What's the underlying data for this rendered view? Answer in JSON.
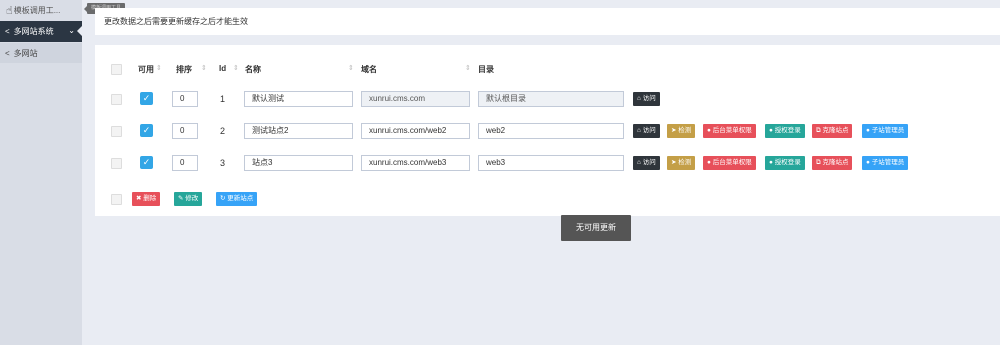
{
  "sidebar": {
    "top_item": "模板调用工...",
    "active_group": "多网站系统",
    "sub_item": "多网站"
  },
  "tooltip": "模板调用工具",
  "notice": "更改数据之后需要更新缓存之后才能生效",
  "table": {
    "headers": {
      "enabled": "可用",
      "order": "排序",
      "id": "Id",
      "name": "名称",
      "domain": "域名",
      "dir": "目录"
    },
    "rows": [
      {
        "order": "0",
        "id": "1",
        "name": "默认测试",
        "domain": "xunrui.cms.com",
        "dir": "默认根目录"
      },
      {
        "order": "0",
        "id": "2",
        "name": "测试站点2",
        "domain": "xunrui.cms.com/web2",
        "dir": "web2"
      },
      {
        "order": "0",
        "id": "3",
        "name": "站点3",
        "domain": "xunrui.cms.com/web3",
        "dir": "web3"
      }
    ]
  },
  "actions": {
    "visit": "访问",
    "check": "检测",
    "menu_perm": "后台菜单权限",
    "auth_login": "授权登录",
    "clone": "克隆站点",
    "sub_admin": "子站管理员"
  },
  "footer": {
    "delete": "删除",
    "edit": "修改",
    "update": "更新站点"
  },
  "toast": "无可用更新",
  "icons": {
    "hand": "hand-pointer-icon",
    "share": "share-icon",
    "chevron": "chevron-down-icon",
    "home": "home-icon",
    "send": "send-icon",
    "user": "user-icon",
    "clone": "clone-icon",
    "users": "users-icon",
    "trash": "trash-icon",
    "edit": "edit-icon",
    "refresh": "refresh-icon"
  },
  "colors": {
    "sidebar_active": "#2b3643",
    "toggle": "#32a6e6",
    "dark": "#2f353b",
    "yellow": "#c49f47",
    "red": "#e7505a",
    "green": "#26a69a",
    "blue": "#3598dc"
  }
}
